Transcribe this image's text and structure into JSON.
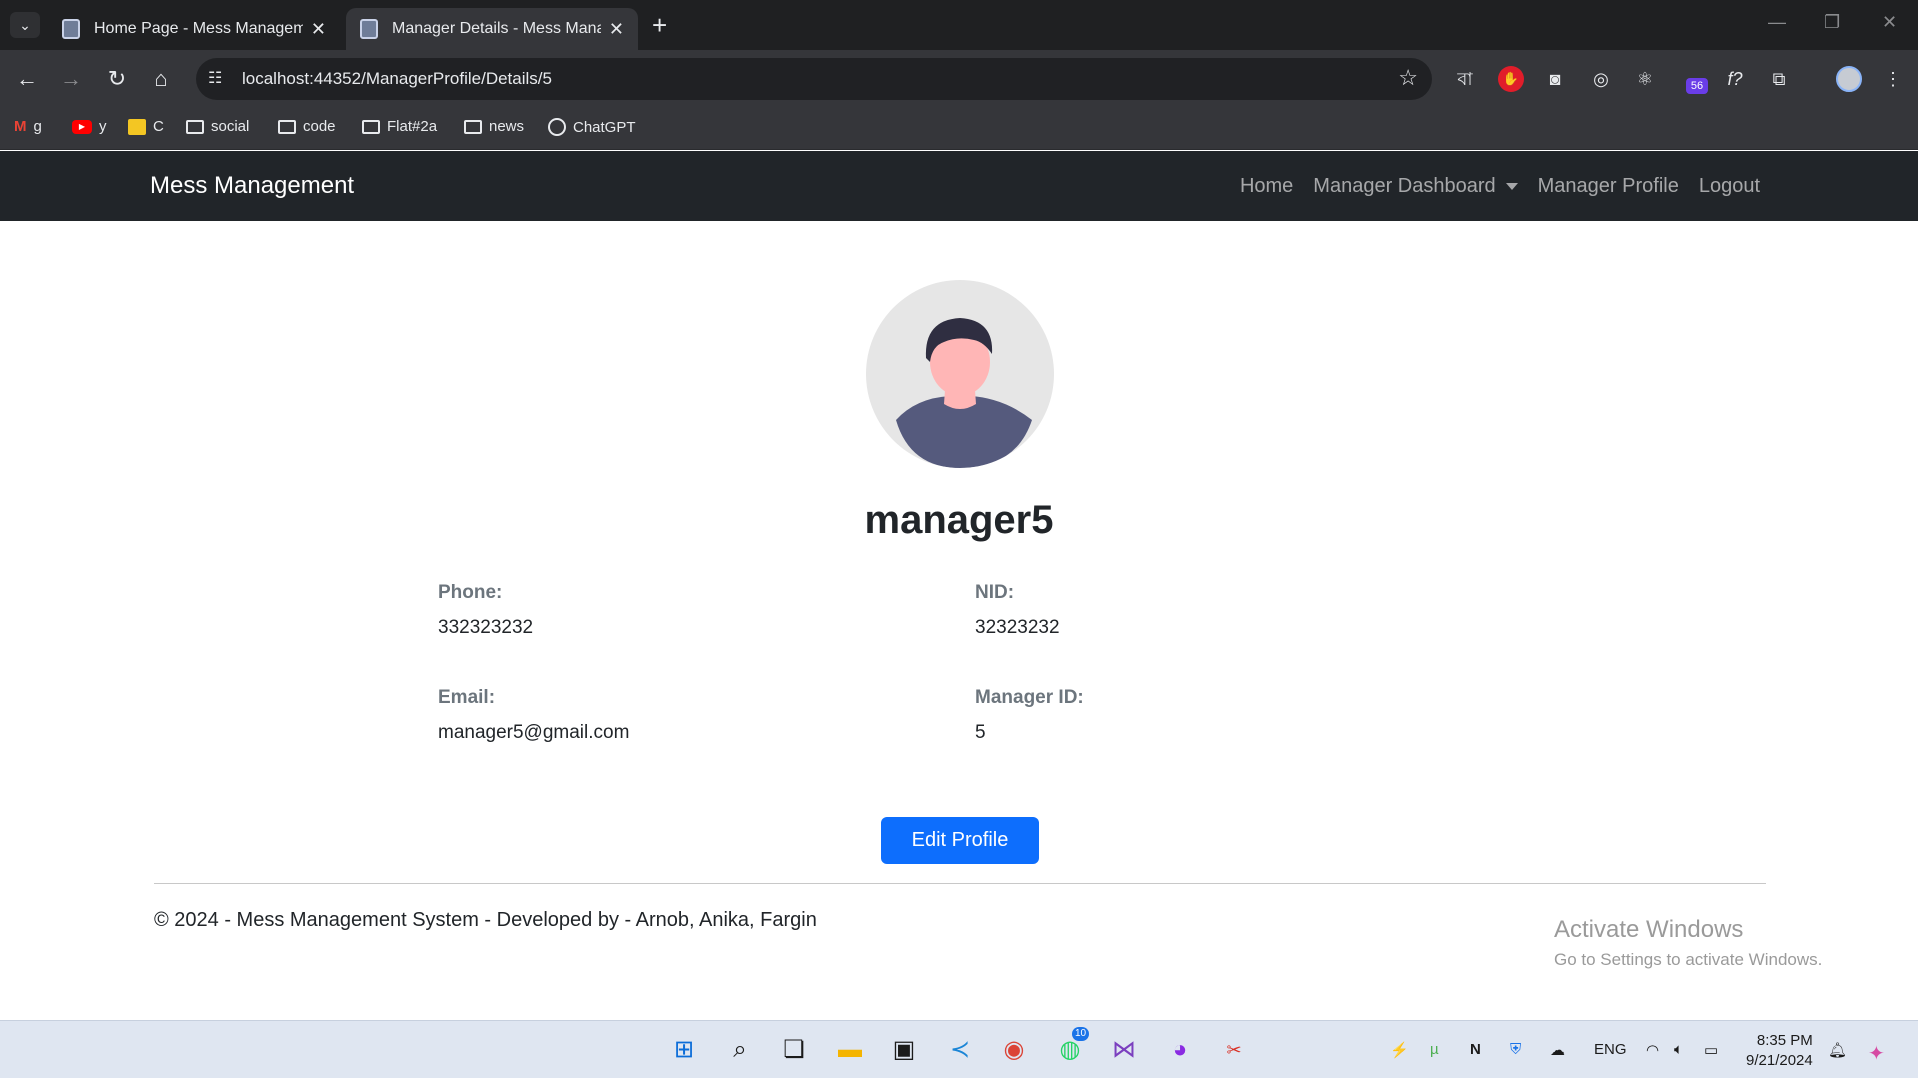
{
  "browser": {
    "tabs": [
      {
        "title": "Home Page - Mess Managemen",
        "active": false
      },
      {
        "title": "Manager Details - Mess Manag",
        "active": true
      }
    ],
    "url": "localhost:44352/ManagerProfile/Details/5",
    "bookmarks": [
      {
        "label": "g",
        "icon": "gmail-icon"
      },
      {
        "label": "y",
        "icon": "youtube-icon"
      },
      {
        "label": "C",
        "icon": "classroom-icon"
      },
      {
        "label": "social",
        "icon": "folder-icon"
      },
      {
        "label": "code",
        "icon": "folder-icon"
      },
      {
        "label": "Flat#2a",
        "icon": "folder-icon"
      },
      {
        "label": "news",
        "icon": "folder-icon"
      },
      {
        "label": "ChatGPT",
        "icon": "chatgpt-icon"
      }
    ],
    "extensions": {
      "bangla": "বা",
      "badge": "56",
      "fx": "f?"
    }
  },
  "site": {
    "brand": "Mess Management",
    "nav": {
      "home": "Home",
      "dashboard": "Manager Dashboard",
      "profile": "Manager Profile",
      "logout": "Logout"
    }
  },
  "profile": {
    "username": "manager5",
    "phone_label": "Phone:",
    "phone": "332323232",
    "nid_label": "NID:",
    "nid": "32323232",
    "email_label": "Email:",
    "email": "manager5@gmail.com",
    "id_label": "Manager ID:",
    "id": "5",
    "edit_button": "Edit Profile"
  },
  "footer": {
    "text": "© 2024 - Mess Management System - Developed by - Arnob, Anika, Fargin"
  },
  "watermark": {
    "title": "Activate Windows",
    "subtitle": "Go to Settings to activate Windows."
  },
  "taskbar": {
    "whatsapp_badge": "10",
    "language": "ENG",
    "time": "8:35 PM",
    "date": "9/21/2024"
  },
  "colors": {
    "navbar": "#212529",
    "primary_button": "#0d6efd",
    "avatar_shirt": "#555a7d",
    "avatar_skin": "#ffb6b6"
  }
}
